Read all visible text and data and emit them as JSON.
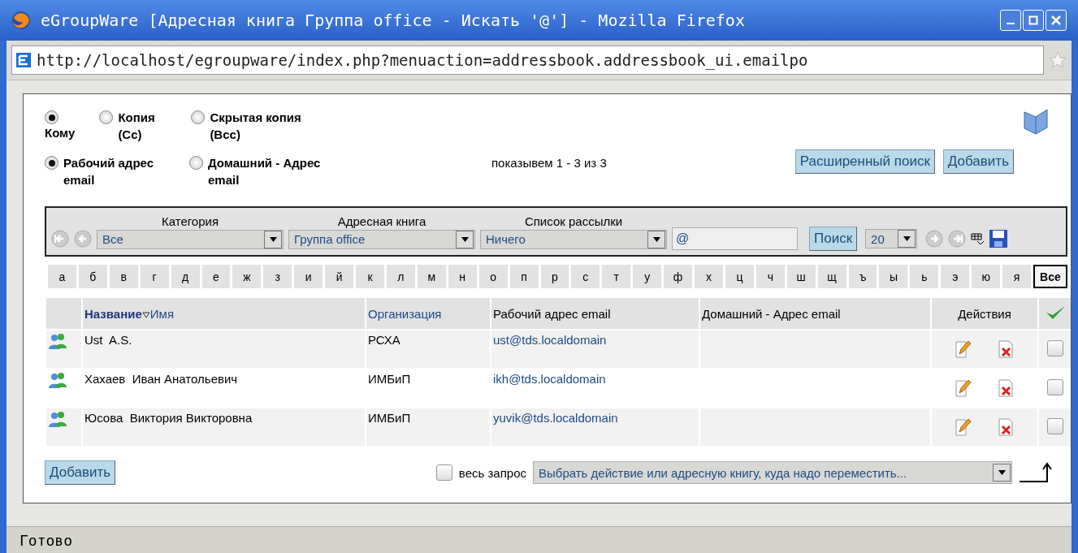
{
  "window": {
    "title": "eGroupWare [Адресная книга Группа office - Искать '@'] - Mozilla Firefox"
  },
  "address_bar": {
    "url": "http://localhost/egroupware/index.php?menuaction=addressbook.addressbook_ui.emailpo"
  },
  "recipient_options": [
    {
      "label": "Кому",
      "selected": true
    },
    {
      "label": "Копия (Cc)",
      "selected": false
    },
    {
      "label": "Скрытая копия (Bcc)",
      "selected": false
    }
  ],
  "address_options": [
    {
      "label": "Рабочий адрес email",
      "selected": true
    },
    {
      "label": "Домашний - Адрес email",
      "selected": false
    }
  ],
  "count_text": "показывем 1 - 3 из 3",
  "top_buttons": [
    "Расширенный поиск",
    "Добавить"
  ],
  "filters": [
    {
      "label": "Категория",
      "value": "Все"
    },
    {
      "label": "Адресная книга",
      "value": "Группа office"
    },
    {
      "label": "Список рассылки",
      "value": "Ничего"
    }
  ],
  "search": {
    "value": "@",
    "button": "Поиск",
    "page_size": "20"
  },
  "letters": [
    {
      "label": "а",
      "selected": false
    },
    {
      "label": "б",
      "selected": false
    },
    {
      "label": "в",
      "selected": false
    },
    {
      "label": "г",
      "selected": false
    },
    {
      "label": "д",
      "selected": false
    },
    {
      "label": "е",
      "selected": false
    },
    {
      "label": "ж",
      "selected": false
    },
    {
      "label": "з",
      "selected": false
    },
    {
      "label": "и",
      "selected": false
    },
    {
      "label": "й",
      "selected": false
    },
    {
      "label": "к",
      "selected": false
    },
    {
      "label": "л",
      "selected": false
    },
    {
      "label": "м",
      "selected": false
    },
    {
      "label": "н",
      "selected": false
    },
    {
      "label": "о",
      "selected": false
    },
    {
      "label": "п",
      "selected": false
    },
    {
      "label": "р",
      "selected": false
    },
    {
      "label": "с",
      "selected": false
    },
    {
      "label": "т",
      "selected": false
    },
    {
      "label": "у",
      "selected": false
    },
    {
      "label": "ф",
      "selected": false
    },
    {
      "label": "х",
      "selected": false
    },
    {
      "label": "ц",
      "selected": false
    },
    {
      "label": "ч",
      "selected": false
    },
    {
      "label": "ш",
      "selected": false
    },
    {
      "label": "щ",
      "selected": false
    },
    {
      "label": "ъ",
      "selected": false
    },
    {
      "label": "ы",
      "selected": false
    },
    {
      "label": "ь",
      "selected": false
    },
    {
      "label": "э",
      "selected": false
    },
    {
      "label": "ю",
      "selected": false
    },
    {
      "label": "я",
      "selected": false
    },
    {
      "label": "Все",
      "selected": true
    }
  ],
  "table": {
    "columns": {
      "name_sort": "Название",
      "name_alt": "Имя",
      "organization": "Организация",
      "work_email": "Рабочий адрес email",
      "home_email": "Домашний - Адрес email",
      "actions": "Действия"
    },
    "rows": [
      {
        "name": "Ust  A.S.",
        "organization": "РСХА",
        "work_email": "ust@tds.localdomain",
        "checked": false
      },
      {
        "name": "Хахаев  Иван Анатольевич",
        "organization": "ИМБиП",
        "work_email": "ikh@tds.localdomain",
        "checked": false
      },
      {
        "name": "Юсова  Виктория Викторовна",
        "organization": "ИМБиП",
        "work_email": "yuvik@tds.localdomain",
        "checked": false
      }
    ]
  },
  "footer": {
    "add_button": "Добавить",
    "whole_query": {
      "label": "весь запрос",
      "checked": false
    },
    "action_select": "Выбрать действие или адресную книгу, куда надо переместить..."
  },
  "status_bar": {
    "text": "Готово"
  }
}
